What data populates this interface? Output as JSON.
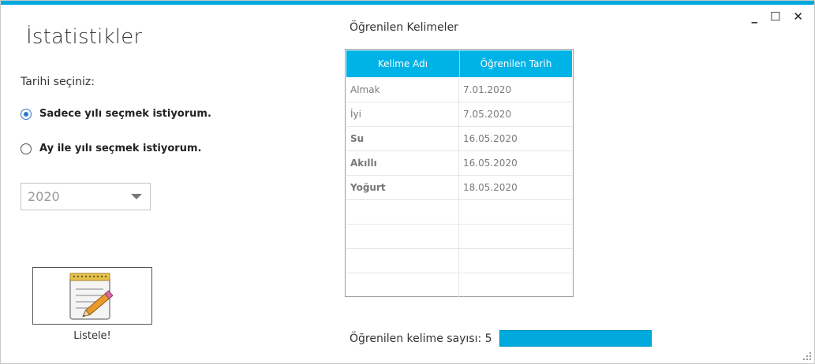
{
  "window": {
    "controls": {
      "minimize": "_",
      "maximize": "☐",
      "close": "✕"
    }
  },
  "page": {
    "title": "İstatistikler",
    "date_label": "Tarihi seçiniz:"
  },
  "options": [
    {
      "label": "Sadece yılı seçmek istiyorum.",
      "checked": true
    },
    {
      "label": "Ay ile yılı seçmek istiyorum.",
      "checked": false
    }
  ],
  "year_combo": {
    "value": "2020"
  },
  "list_button": {
    "label": "Listele!",
    "icon": "notepad-pencil-icon"
  },
  "words": {
    "title": "Öğrenilen Kelimeler",
    "columns": [
      "Kelime Adı",
      "Öğrenilen Tarih"
    ],
    "rows": [
      {
        "word": "Almak",
        "date": "7.01.2020"
      },
      {
        "word": "İyi",
        "date": "7.05.2020"
      },
      {
        "word": "Su",
        "date": "16.05.2020"
      },
      {
        "word": "Akıllı",
        "date": "16.05.2020"
      },
      {
        "word": "Yoğurt",
        "date": "18.05.2020"
      },
      {
        "word": "",
        "date": ""
      },
      {
        "word": "",
        "date": ""
      },
      {
        "word": "",
        "date": ""
      },
      {
        "word": "",
        "date": ""
      }
    ]
  },
  "count": {
    "label": "Öğrenilen kelime sayısı: 5",
    "progress": 1.0
  },
  "colors": {
    "accent": "#00a8df",
    "header": "#00b3e6",
    "progress": "#00aadd"
  }
}
